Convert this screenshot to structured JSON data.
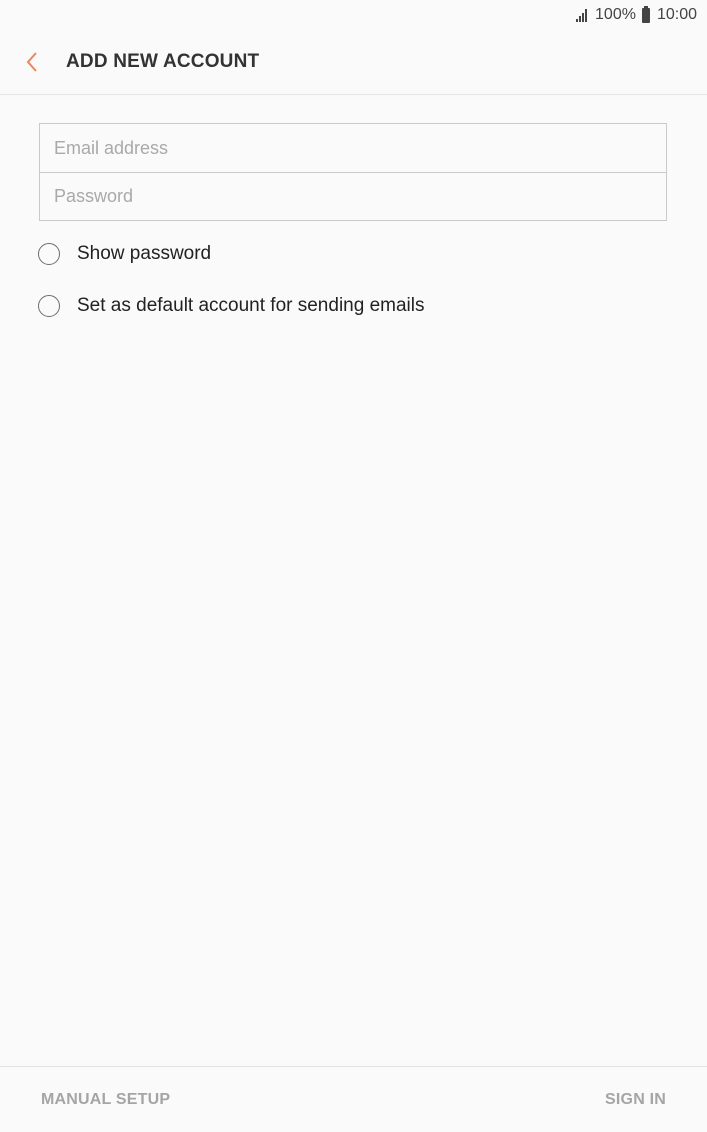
{
  "status_bar": {
    "battery": "100%",
    "time": "10:00",
    "icons": [
      "signal-icon",
      "battery-icon"
    ]
  },
  "header": {
    "title": "ADD NEW ACCOUNT",
    "back_icon": "chevron-left-icon",
    "accent_color": "#f0845c"
  },
  "form": {
    "email": {
      "value": "",
      "placeholder": "Email address"
    },
    "password": {
      "value": "",
      "placeholder": "Password"
    }
  },
  "options": {
    "show_password": {
      "label": "Show password",
      "checked": false
    },
    "default_account": {
      "label": "Set as default account for sending emails",
      "checked": false
    }
  },
  "footer": {
    "manual_setup": "MANUAL SETUP",
    "sign_in": "SIGN IN"
  }
}
